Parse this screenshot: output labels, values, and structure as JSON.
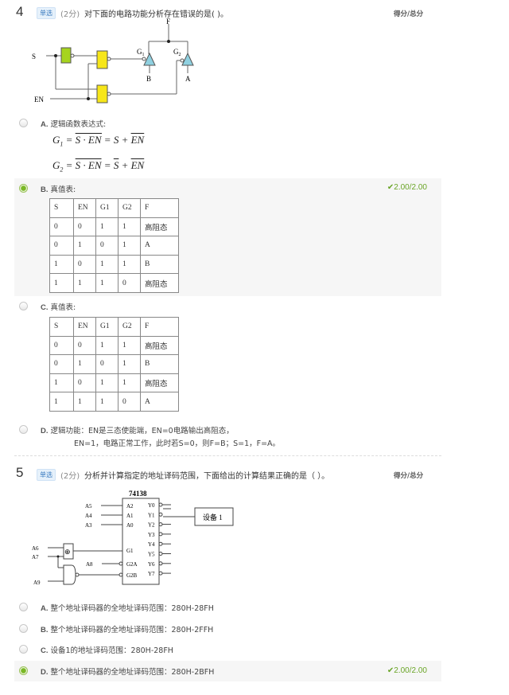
{
  "q4": {
    "number": "4",
    "type_badge": "单选",
    "points": "(2分)",
    "text": "对下面的电路功能分析存在错误的是(  )。",
    "score_label": "得分/总分",
    "diagram": {
      "S": "S",
      "EN": "EN",
      "G1": "G",
      "G1_sub": "1",
      "G2": "G",
      "G2_sub": "2",
      "F": "F",
      "A": "A",
      "B": "B"
    },
    "options": [
      {
        "letter": "A.",
        "text": "逻辑函数表达式:",
        "formula1": {
          "lhs": "G",
          "sub": "1",
          "mid": "S · EN",
          "rhs": "= S + ",
          "rhs_bar": "EN"
        },
        "formula2": {
          "lhs": "G",
          "sub": "2",
          "mid": "S · EN",
          "rhs_bar_s": "S",
          "rhs": " + ",
          "rhs_bar": "EN"
        },
        "selected": false
      },
      {
        "letter": "B.",
        "text": "真值表:",
        "selected": true,
        "result": "2.00/2.00",
        "table": [
          [
            "S",
            "EN",
            "G1",
            "G2",
            "F"
          ],
          [
            "0",
            "0",
            "1",
            "1",
            "高阻态"
          ],
          [
            "0",
            "1",
            "0",
            "1",
            "A"
          ],
          [
            "1",
            "0",
            "1",
            "1",
            "B"
          ],
          [
            "1",
            "1",
            "1",
            "0",
            "高阻态"
          ]
        ]
      },
      {
        "letter": "C.",
        "text": "真值表:",
        "selected": false,
        "table": [
          [
            "S",
            "EN",
            "G1",
            "G2",
            "F"
          ],
          [
            "0",
            "0",
            "1",
            "1",
            "高阻态"
          ],
          [
            "0",
            "1",
            "0",
            "1",
            "B"
          ],
          [
            "1",
            "0",
            "1",
            "1",
            "高阻态"
          ],
          [
            "1",
            "1",
            "1",
            "0",
            "A"
          ]
        ]
      },
      {
        "letter": "D.",
        "text": "逻辑功能：EN是三态使能端，EN=0电路输出高阻态，",
        "text2": "EN=1，电路正常工作，此时若S=0，则F=B；S=1，F=A。",
        "selected": false
      }
    ]
  },
  "q5": {
    "number": "5",
    "type_badge": "单选",
    "points": "(2分)",
    "text": "分析并计算指定的地址译码范围，下面给出的计算结果正确的是（ ）。",
    "score_label": "得分/总分",
    "diagram": {
      "chip": "74138",
      "inputs_left": [
        "A5",
        "A4",
        "A3",
        "A6",
        "A7",
        "A8",
        "A9"
      ],
      "pins_in": [
        "A2",
        "A1",
        "A0",
        "G1",
        "G2A",
        "G2B"
      ],
      "pins_out": [
        "Y0",
        "Y1",
        "Y2",
        "Y3",
        "Y4",
        "Y5",
        "Y6",
        "Y7"
      ],
      "device": "设备 1",
      "xor": "⊕"
    },
    "options": [
      {
        "letter": "A.",
        "text": "整个地址译码器的全地址译码范围：280H-28FH",
        "selected": false
      },
      {
        "letter": "B.",
        "text": "整个地址译码器的全地址译码范围：280H-2FFH",
        "selected": false
      },
      {
        "letter": "C.",
        "text": "设备1的地址译码范围：280H-28FH",
        "selected": false
      },
      {
        "letter": "D.",
        "text": "整个地址译码器的全地址译码范围：280H-2BFH",
        "selected": true,
        "result": "2.00/2.00"
      }
    ]
  },
  "colors": {
    "correct": "#6aa527",
    "gate_yellow": "#f7e619",
    "gate_green": "#a6d41e",
    "buffer_blue": "#8fd0e0"
  }
}
